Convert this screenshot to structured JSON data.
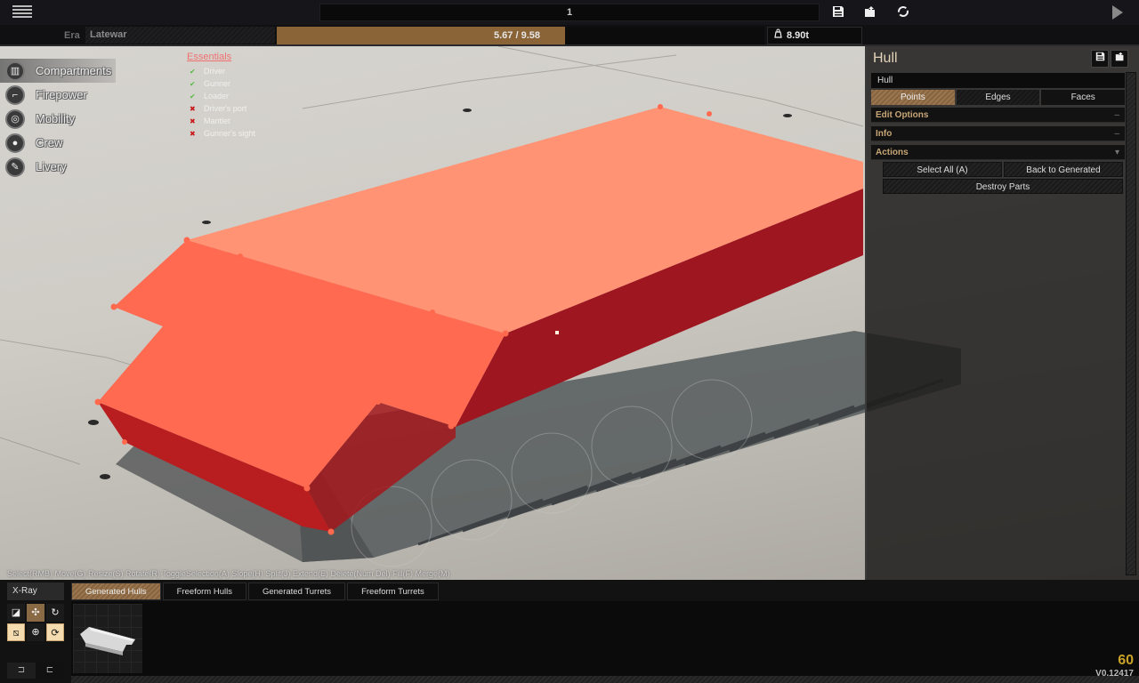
{
  "topbar": {
    "menu_icon": "hamburger-menu-icon",
    "design_name": "1",
    "save_icon": "floppy-disk-icon",
    "load_icon": "folder-open-icon",
    "reset_icon": "refresh-icon",
    "play_icon": "play-icon"
  },
  "stats": {
    "era_label": "Era",
    "era_value": "Latewar",
    "weight_text": "5.67 / 9.58",
    "weight_fraction": 0.592,
    "weight_fill_color": "#8a6436",
    "tonnage_icon": "weight-icon",
    "tonnage": "8.90t"
  },
  "categories": [
    {
      "label": "Compartments",
      "icon": "book-icon",
      "active": true
    },
    {
      "label": "Firepower",
      "icon": "cannon-icon",
      "active": false
    },
    {
      "label": "Mobility",
      "icon": "wheel-icon",
      "active": false
    },
    {
      "label": "Crew",
      "icon": "person-icon",
      "active": false
    },
    {
      "label": "Livery",
      "icon": "paintbrush-icon",
      "active": false
    }
  ],
  "essentials": {
    "title": "Essentials",
    "items": [
      {
        "label": "Driver",
        "ok": true
      },
      {
        "label": "Gunner",
        "ok": true
      },
      {
        "label": "Loader",
        "ok": true
      },
      {
        "label": "Driver's port",
        "ok": false
      },
      {
        "label": "Mantlet",
        "ok": false
      },
      {
        "label": "Gunner's sight",
        "ok": false
      }
    ],
    "ok_color": "#55bb44",
    "bad_color": "#c81818"
  },
  "hint": "Select(RMB) Move(G) Resize(S) Rotate(R) ToggleSelection(A) Slope(H) Split(J) Extend(E) Delete(Num Del) Fill(F) Merge(M)",
  "panel": {
    "title": "Hull",
    "name_value": "Hull",
    "tabs": [
      {
        "label": "Points",
        "active": true
      },
      {
        "label": "Edges",
        "active": false
      },
      {
        "label": "Faces",
        "active": false
      }
    ],
    "sections": [
      {
        "label": "Edit Options",
        "toggle": "–"
      },
      {
        "label": "Info",
        "toggle": "–"
      },
      {
        "label": "Actions",
        "toggle": "▾"
      }
    ],
    "actions": {
      "select_all": "Select All (A)",
      "back_to_generated": "Back to Generated",
      "destroy_parts": "Destroy Parts"
    }
  },
  "bottom": {
    "xray_label": "X-Ray",
    "tools": [
      {
        "icon": "resize-icon",
        "glyph": "◪",
        "state": "normal"
      },
      {
        "icon": "move-icon",
        "glyph": "✣",
        "state": "selected"
      },
      {
        "icon": "rotate-icon",
        "glyph": "↻",
        "state": "normal"
      },
      {
        "icon": "snap-icon",
        "glyph": "⧅",
        "state": "highlight"
      },
      {
        "icon": "sphere-grid-icon",
        "glyph": "⊕",
        "state": "normal"
      },
      {
        "icon": "orbit-icon",
        "glyph": "⟳",
        "state": "highlight"
      }
    ],
    "undo_icon": "undo-icon",
    "redo_icon": "redo-icon",
    "undo_glyph": "⊐",
    "redo_glyph": "⊏",
    "library_tabs": [
      {
        "label": "Generated Hulls",
        "active": true
      },
      {
        "label": "Freeform Hulls",
        "active": false
      },
      {
        "label": "Generated Turrets",
        "active": false
      },
      {
        "label": "Freeform Turrets",
        "active": false
      }
    ],
    "fps": "60",
    "version": "V0.12417"
  }
}
